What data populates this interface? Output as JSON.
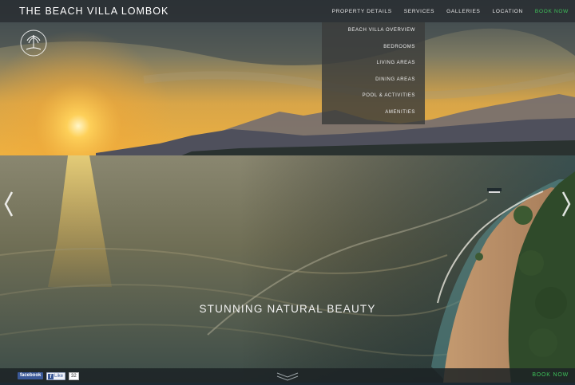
{
  "header": {
    "brand": "THE BEACH VILLA LOMBOK",
    "nav": [
      {
        "label": "PROPERTY DETAILS"
      },
      {
        "label": "SERVICES"
      },
      {
        "label": "GALLERIES"
      },
      {
        "label": "LOCATION"
      },
      {
        "label": "BOOK NOW"
      }
    ]
  },
  "dropdown": {
    "items": [
      {
        "label": "BEACH VILLA OVERVIEW"
      },
      {
        "label": "BEDROOMS"
      },
      {
        "label": "LIVING AREAS"
      },
      {
        "label": "DINING AREAS"
      },
      {
        "label": "POOL & ACTIVITIES"
      },
      {
        "label": "AMENITIES"
      }
    ]
  },
  "hero": {
    "tagline": "STUNNING NATURAL BEAUTY"
  },
  "footer": {
    "facebook_label": "facebook",
    "like_label": "Like",
    "like_count": "32",
    "book_label": "BOOK NOW"
  },
  "icons": {
    "logo": "villa-logo-icon",
    "prev": "chevron-left-icon",
    "next": "chevron-right-icon",
    "scroll": "chevron-down-icon"
  },
  "colors": {
    "accent_green": "#3ec25a",
    "facebook_blue": "#3b5998",
    "topbar": "#2c3034"
  }
}
